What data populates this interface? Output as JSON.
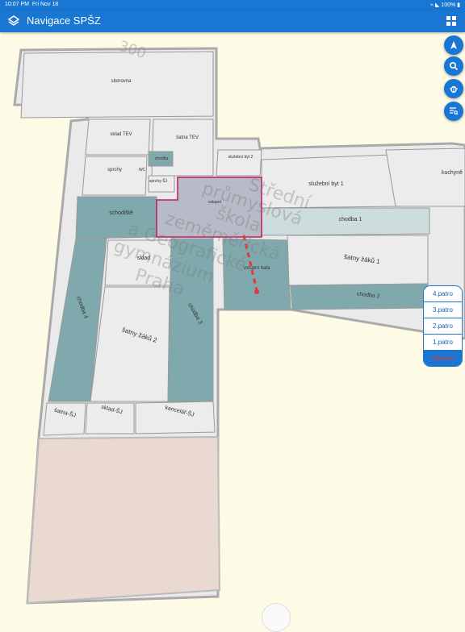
{
  "status": {
    "time": "10:07 PM",
    "date": "Fri Nov 18",
    "battery": "100%"
  },
  "app": {
    "title": "Navigace SPŠZ",
    "icons": {
      "layers": "layers-icon",
      "grid": "grid-icon"
    }
  },
  "fabs": [
    {
      "name": "navigate-button",
      "icon": "navigation-arrow-icon"
    },
    {
      "name": "search-button",
      "icon": "search-icon"
    },
    {
      "name": "debug-button",
      "icon": "bug-icon"
    },
    {
      "name": "filter-button",
      "icon": "search-list-icon"
    }
  ],
  "floors": [
    "4.patro",
    "3.patro",
    "2.patro",
    "1.patro",
    "přízemí"
  ],
  "selected_floor": "přízemí",
  "map": {
    "watermark": [
      "Střední",
      "průmyslová",
      "škola",
      "zeměměřická",
      "a Geografické",
      "gymnázium",
      "Praha"
    ],
    "label_300": "300",
    "rooms": {
      "sborovna": "sborovna",
      "sklad_tev": "sklad TEV",
      "satna_tev": "šatna TEV",
      "sprchy": "sprchy",
      "chodba_small": "chodba",
      "wc": "WC",
      "sprchy_sj": "sprchy-ŠJ",
      "sluzebni_byt_2": "služební byt 2",
      "sluzebni_byt_1": "služební byt 1",
      "kuchyne": "kuchyně",
      "schodiste": "schodiště",
      "vstup": "vstupní",
      "chodba_1": "chodba 1",
      "sklad": "sklad",
      "vstupni_hala": "vstupní hala",
      "satny_zaku_1": "šatny žáků 1",
      "chodba_2": "chodba 2",
      "chodba_4": "chodba 4",
      "chodba_3": "chodba 3",
      "satny_zaku_2": "šatny žáků 2",
      "satna_sj": "šatna-ŠJ",
      "sklad_sj": "sklad-ŠJ",
      "kancelar_sj": "kancelář-ŠJ"
    },
    "colors": {
      "room": "#ececec",
      "corridor": "#7fa9ad",
      "selected": "#c2185b",
      "route": "#e53935",
      "wall": "#b0b0b0"
    }
  }
}
